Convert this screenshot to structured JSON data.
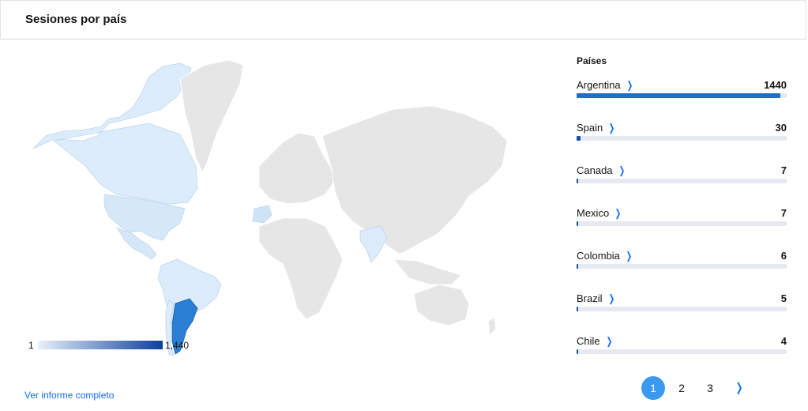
{
  "header": {
    "title": "Sesiones por país"
  },
  "map": {
    "legend_min": "1",
    "legend_max": "1,440",
    "colors": {
      "highest": "#2a7fd4",
      "medium": "#cfe3f7",
      "low": "#dcecfb",
      "none": "#e6e6e6",
      "border": "#ffffff"
    }
  },
  "report_link": "Ver informe completo",
  "panel": {
    "title": "Países",
    "countries": [
      {
        "name": "Argentina",
        "value": "1440",
        "share": 1.0
      },
      {
        "name": "Spain",
        "value": "30",
        "share": 0.0208
      },
      {
        "name": "Canada",
        "value": "7",
        "share": 0.0049
      },
      {
        "name": "Mexico",
        "value": "7",
        "share": 0.0049
      },
      {
        "name": "Colombia",
        "value": "6",
        "share": 0.0042
      },
      {
        "name": "Brazil",
        "value": "5",
        "share": 0.0035
      },
      {
        "name": "Chile",
        "value": "4",
        "share": 0.0028
      }
    ]
  },
  "pagination": {
    "pages": [
      "1",
      "2",
      "3"
    ],
    "current": "1",
    "next_icon": "chevron-right-icon"
  }
}
